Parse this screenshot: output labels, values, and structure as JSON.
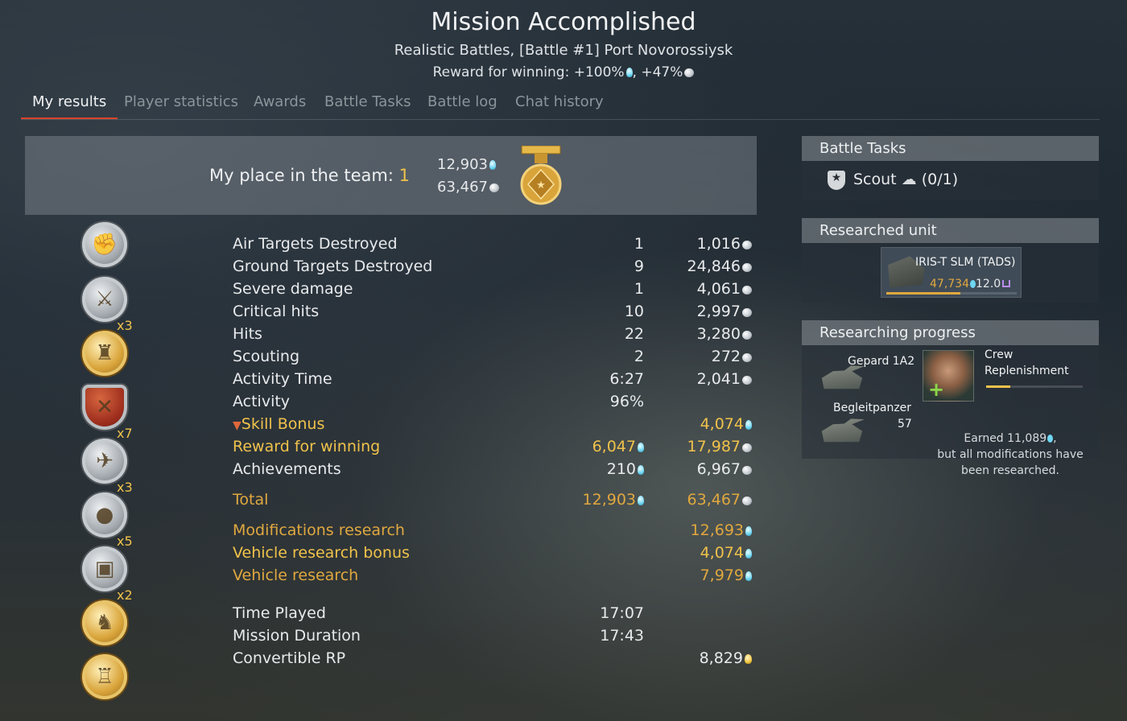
{
  "header": {
    "title": "Mission Accomplished",
    "subtitle": "Realistic Battles, [Battle #1] Port Novorossiysk",
    "reward_prefix": "Reward for winning: +100%",
    "reward_sep": ", +47%"
  },
  "tabs": [
    {
      "label": "My results",
      "active": true
    },
    {
      "label": "Player statistics"
    },
    {
      "label": "Awards"
    },
    {
      "label": "Battle Tasks"
    },
    {
      "label": "Battle log"
    },
    {
      "label": "Chat history"
    }
  ],
  "place": {
    "label": "My place in the team: ",
    "value": "1",
    "rp": "12,903",
    "sl": "63,467"
  },
  "results": [
    {
      "label": "Air Targets Destroyed",
      "v1": "1",
      "v2": "1,016"
    },
    {
      "label": "Ground Targets Destroyed",
      "v1": "9",
      "v2": "24,846"
    },
    {
      "label": "Severe damage",
      "v1": "1",
      "v2": "4,061"
    },
    {
      "label": "Critical hits",
      "v1": "10",
      "v2": "2,997"
    },
    {
      "label": "Hits",
      "v1": "22",
      "v2": "3,280"
    },
    {
      "label": "Scouting",
      "v1": "2",
      "v2": "272"
    },
    {
      "label": "Activity Time",
      "v1": "6:27",
      "v2": "2,041"
    },
    {
      "label": "Activity",
      "v1": "96%",
      "v2": ""
    },
    {
      "label": "Skill Bonus",
      "v1": "",
      "v2": "4,074"
    },
    {
      "label": "Reward for winning",
      "v1": "6,047",
      "v2": "17,987"
    },
    {
      "label": "Achievements",
      "v1": "210",
      "v2": "6,967"
    }
  ],
  "total": {
    "label": "Total",
    "rp": "12,903",
    "sl": "63,467"
  },
  "research": [
    {
      "label": "Modifications research",
      "value": "12,693"
    },
    {
      "label": "Vehicle research bonus",
      "value": "4,074"
    },
    {
      "label": "Vehicle research",
      "value": "7,979"
    }
  ],
  "times": [
    {
      "label": "Time Played",
      "value": "17:07"
    },
    {
      "label": "Mission Duration",
      "value": "17:43"
    },
    {
      "label": "Convertible RP",
      "value": "8,829"
    }
  ],
  "awards": [
    {
      "icon": "fist-medal-icon",
      "style": "silver",
      "mult": ""
    },
    {
      "icon": "crossed-swords-medal-icon",
      "style": "silver",
      "mult": "x3"
    },
    {
      "icon": "soldier-medal-icon",
      "style": "gold",
      "mult": ""
    },
    {
      "icon": "crossed-shields-medal-icon",
      "style": "shield",
      "mult": "x7"
    },
    {
      "icon": "eagle-medal-icon",
      "style": "silver",
      "mult": "x3"
    },
    {
      "icon": "bomb-wreath-medal-icon",
      "style": "silver",
      "mult": "x5"
    },
    {
      "icon": "tank-medal-icon",
      "style": "silver",
      "mult": "x2"
    },
    {
      "icon": "lion-medal-icon",
      "style": "gold",
      "mult": ""
    },
    {
      "icon": "fortress-medal-icon",
      "style": "gold",
      "mult": ""
    }
  ],
  "battle_tasks": {
    "title": "Battle Tasks",
    "task": "Scout",
    "progress": "(0/1)"
  },
  "researched_unit": {
    "title": "Researched unit",
    "name": "IRIS-T SLM (TADS)",
    "rp": "47,734",
    "br": "12.0",
    "progress_fraction": 0.57
  },
  "researching": {
    "title": "Researching progress",
    "vehicle1": "Gepard 1A2",
    "vehicle2": "Begleitpanzer",
    "vehicle2_value": "57",
    "crew_title_1": "Crew",
    "crew_title_2": "Replenishment",
    "crew_progress_fraction": 0.25,
    "earned_prefix": "Earned 11,089",
    "earned_suffix": ",",
    "note_line1": "but all modifications have",
    "note_line2": "been researched."
  },
  "colors": {
    "accent_tab": "#d9432b",
    "gold": "#f0c24b",
    "orange": "#e0a83f",
    "rp_blue": "#6fd6f2"
  }
}
